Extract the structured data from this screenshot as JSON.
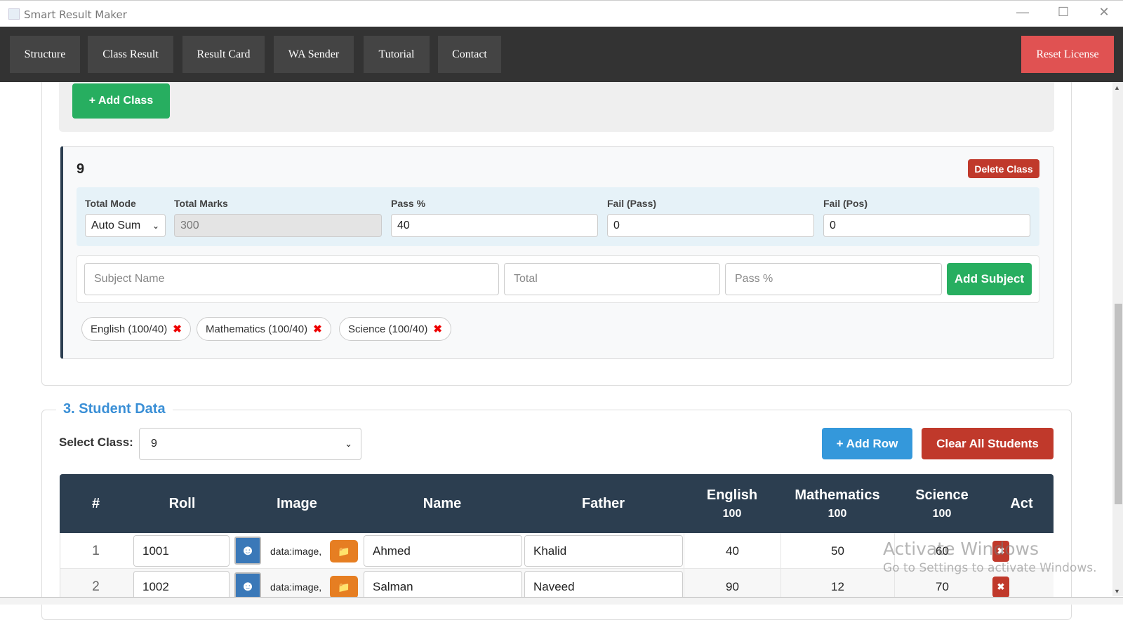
{
  "window": {
    "title": "Smart Result Maker"
  },
  "nav": {
    "items": [
      "Structure",
      "Class Result",
      "Result Card",
      "WA Sender",
      "Tutorial",
      "Contact"
    ],
    "reset": "Reset License"
  },
  "add_class": "+ Add Class",
  "class_card": {
    "name": "9",
    "delete": "Delete Class",
    "total_mode_label": "Total Mode",
    "total_mode_value": "Auto Sum",
    "total_marks_label": "Total Marks",
    "total_marks_value": "300",
    "pass_label": "Pass %",
    "pass_value": "40",
    "fail_pass_label": "Fail (Pass)",
    "fail_pass_value": "0",
    "fail_pos_label": "Fail (Pos)",
    "fail_pos_value": "0",
    "subject_placeholder": "Subject Name",
    "total_placeholder": "Total",
    "pass_placeholder": "Pass %",
    "add_subject": "Add Subject",
    "subjects": [
      "English (100/40)",
      "Mathematics (100/40)",
      "Science (100/40)"
    ]
  },
  "student": {
    "legend": "3. Student Data",
    "select_label": "Select Class:",
    "select_value": "9",
    "add_row": "+ Add Row",
    "clear_all": "Clear All Students",
    "headers": {
      "num": "#",
      "roll": "Roll",
      "image": "Image",
      "name": "Name",
      "father": "Father",
      "english": "English",
      "english_total": "100",
      "math": "Mathematics",
      "math_total": "100",
      "science": "Science",
      "science_total": "100",
      "act": "Act"
    },
    "rows": [
      {
        "n": "1",
        "roll": "1001",
        "img": "data:image,",
        "name": "Ahmed",
        "father": "Khalid",
        "english": "40",
        "math": "50",
        "science": "60"
      },
      {
        "n": "2",
        "roll": "1002",
        "img": "data:image,",
        "name": "Salman",
        "father": "Naveed",
        "english": "90",
        "math": "12",
        "science": "70"
      }
    ]
  },
  "watermark": {
    "line1": "Activate Windows",
    "line2": "Go to Settings to activate Windows."
  }
}
